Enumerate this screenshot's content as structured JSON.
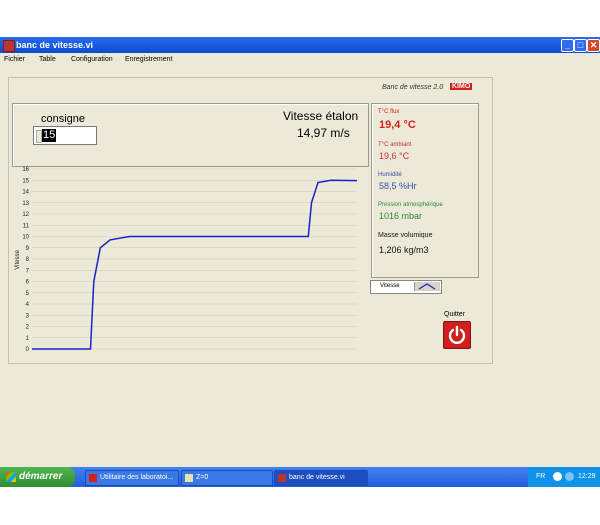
{
  "window": {
    "title": "banc de vitesse.vi"
  },
  "menu": [
    "Fichier",
    "Table",
    "Configuration",
    "Enregistrement"
  ],
  "brand": {
    "text": "Banc de vitesse 2.0",
    "logo": "KIMO",
    "logo_color": "#d4201a"
  },
  "consigne": {
    "label": "consigne",
    "value": "15"
  },
  "etalon": {
    "label": "Vitesse étalon",
    "value": "14,97 m/s"
  },
  "sensors": {
    "tflux": {
      "label": "T°C flux",
      "value": "19,4 °C",
      "color": "#d42020"
    },
    "tambiant": {
      "label": "T°C ambiant",
      "value": "19,6 °C",
      "color": "#c83030"
    },
    "humidite": {
      "label": "Humidité",
      "value": "58,5 %Hr",
      "color": "#3a4aa8"
    },
    "pression": {
      "label": "Pression atmosphérique",
      "value": "1016 mbar",
      "color": "#2a8a3a"
    },
    "masse": {
      "label": "Masse volumique",
      "value": "1,206 kg/m3",
      "color": "#111111"
    }
  },
  "selector": {
    "label": "Vitesse"
  },
  "quit": {
    "label": "Quitter"
  },
  "chart_data": {
    "type": "line",
    "ylabel": "Vitesse",
    "ylim": [
      0,
      16
    ],
    "yticks": [
      "0",
      "1",
      "2",
      "3",
      "4",
      "5",
      "6",
      "7",
      "8",
      "9",
      "10",
      "11",
      "12",
      "13",
      "14",
      "15",
      "16"
    ],
    "grid": true,
    "line_color": "#1a22c8",
    "series": [
      {
        "points": [
          [
            0,
            0
          ],
          [
            18,
            0
          ],
          [
            19,
            6
          ],
          [
            21,
            9
          ],
          [
            24,
            9.7
          ],
          [
            30,
            10
          ],
          [
            80,
            10
          ],
          [
            85,
            10
          ],
          [
            86,
            13
          ],
          [
            88,
            14.8
          ],
          [
            92,
            15
          ],
          [
            100,
            14.97
          ]
        ]
      }
    ]
  },
  "taskbar": {
    "start": "démarrer",
    "items": [
      {
        "label": "Utilitaire des laboratoi...",
        "active": false
      },
      {
        "label": "Z=0",
        "active": false
      },
      {
        "label": "banc de vitesse.vi",
        "active": true
      }
    ],
    "lang": "FR",
    "clock": "12:29"
  }
}
